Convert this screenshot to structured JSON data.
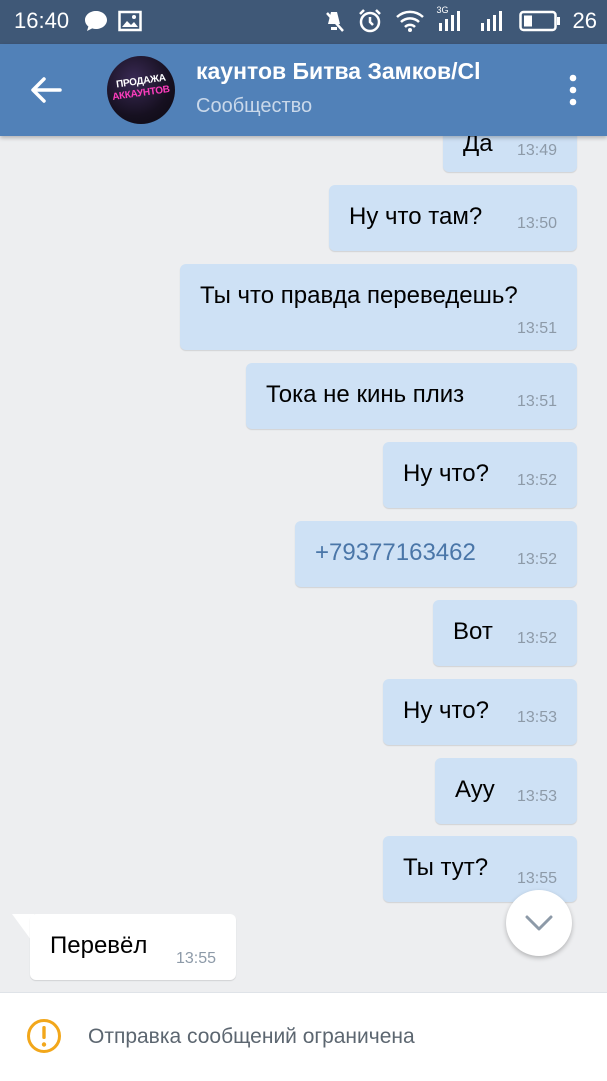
{
  "status_bar": {
    "time": "16:40",
    "network_label": "3G",
    "battery_percent": "26",
    "icons": [
      "chat-bubble-icon",
      "image-icon",
      "mute-icon",
      "alarm-icon",
      "wifi-icon",
      "signal-icon",
      "battery-icon"
    ]
  },
  "header": {
    "title": "каунтов Битва Замков/Cl",
    "subtitle": "Сообщество",
    "avatar_line1": "ПРОДАЖА",
    "avatar_line2": "АККАУНТОВ"
  },
  "messages": [
    {
      "direction": "out",
      "text": "Да",
      "time": "13:49"
    },
    {
      "direction": "out",
      "text": "Ну что там?",
      "time": "13:50"
    },
    {
      "direction": "out",
      "text": "Ты что правда переведешь?",
      "time": "13:51"
    },
    {
      "direction": "out",
      "text": "Тока не кинь плиз",
      "time": "13:51"
    },
    {
      "direction": "out",
      "text": "Ну что?",
      "time": "13:52"
    },
    {
      "direction": "out",
      "text": "+79377163462",
      "time": "13:52"
    },
    {
      "direction": "out",
      "text": "Вот",
      "time": "13:52"
    },
    {
      "direction": "out",
      "text": "Ну что?",
      "time": "13:53"
    },
    {
      "direction": "out",
      "text": "Ауу",
      "time": "13:53"
    },
    {
      "direction": "out",
      "text": "Ты тут?",
      "time": "13:55"
    },
    {
      "direction": "in",
      "text": "Перевёл",
      "time": "13:55"
    }
  ],
  "footer": {
    "notice": "Отправка сообщений ограничена"
  },
  "colors": {
    "status_bar": "#3f5877",
    "app_bar": "#5181b8",
    "outgoing_bubble": "#cee1f5",
    "incoming_bubble": "#ffffff",
    "chat_background": "#edeef0",
    "warning": "#f2a71b",
    "link": "#4a76a8"
  }
}
